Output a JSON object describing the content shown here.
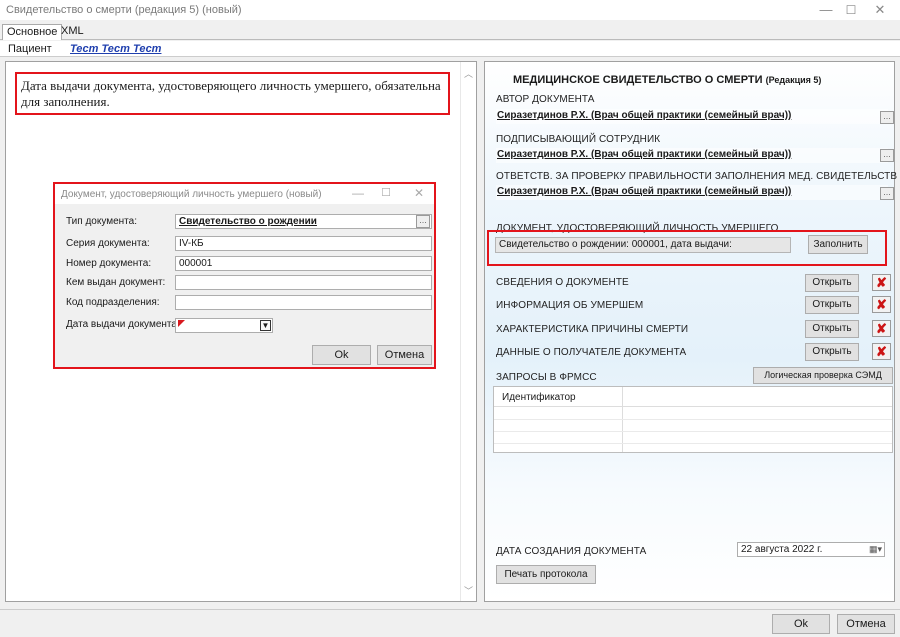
{
  "window": {
    "title": "Свидетельство о смерти (редакция 5) (новый)",
    "minimize_icon": "minimize-icon",
    "maximize_icon": "maximize-icon",
    "close_icon": "close-icon"
  },
  "tabs": [
    {
      "label": "Основное",
      "active": true
    },
    {
      "label": "XML",
      "active": false
    }
  ],
  "patient": {
    "label": "Пациент",
    "value": "Тест Тест Тест"
  },
  "left": {
    "message": "Дата выдачи документа, удостоверяющего личность умершего, обязательна для заполнения."
  },
  "dialog": {
    "title": "Документ, удостоверяющий личность умершего (новый)",
    "fields": {
      "doc_type_label": "Тип документа:",
      "doc_type_value": "Свидетельство о рождении",
      "series_label": "Серия документа:",
      "series_value": "IV-КБ",
      "number_label": "Номер документа:",
      "number_value": "000001",
      "issued_by_label": "Кем выдан документ:",
      "issued_by_value": "",
      "dept_code_label": "Код подразделения:",
      "dept_code_value": "",
      "issue_date_label": "Дата выдачи документа:",
      "issue_date_value": ""
    },
    "ok_label": "Ok",
    "cancel_label": "Отмена"
  },
  "right": {
    "title_main": "МЕДИЦИНСКОЕ СВИДЕТЕЛЬСТВО О СМЕРТИ",
    "title_small": "(Редакция 5)",
    "author_label": "АВТОР ДОКУМЕНТА",
    "author_value": "Сиразетдинов Р.Х. (Врач общей практики (семейный врач))",
    "signer_label": "ПОДПИСЫВАЮЩИЙ СОТРУДНИК",
    "signer_value": "Сиразетдинов Р.Х. (Врач общей практики (семейный врач))",
    "checker_label": "ОТВЕТСТВ. ЗА ПРОВЕРКУ ПРАВИЛЬНОСТИ ЗАПОЛНЕНИЯ МЕД. СВИДЕТЕЛЬСТВ",
    "checker_value": "Сиразетдинов Р.Х. (Врач общей практики (семейный врач))",
    "identity_doc_label": "ДОКУМЕНТ, УДОСТОВЕРЯЮЩИЙ ЛИЧНОСТЬ УМЕРШЕГО",
    "identity_doc_value": "Свидетельство о рождении: 000001, дата выдачи:",
    "fill_label": "Заполнить",
    "sections": [
      {
        "label": "СВЕДЕНИЯ О ДОКУМЕНТЕ",
        "button": "Открыть"
      },
      {
        "label": "ИНФОРМАЦИЯ ОБ УМЕРШЕМ",
        "button": "Открыть"
      },
      {
        "label": "ХАРАКТЕРИСТИКА ПРИЧИНЫ СМЕРТИ",
        "button": "Открыть"
      },
      {
        "label": "ДАННЫЕ О ПОЛУЧАТЕЛЕ ДОКУМЕНТА",
        "button": "Открыть"
      }
    ],
    "frmss_label": "ЗАПРОСЫ В ФРМСС",
    "semd_check_label": "Логическая проверка СЭМД",
    "grid_header": "Идентификатор",
    "created_label": "ДАТА СОЗДАНИЯ ДОКУМЕНТА",
    "created_value": "22 августа 2022 г.",
    "print_label": "Печать протокола"
  },
  "footer": {
    "ok_label": "Ok",
    "cancel_label": "Отмена"
  },
  "colors": {
    "alert_red": "#e3141b",
    "link_blue": "#1f3fae"
  }
}
